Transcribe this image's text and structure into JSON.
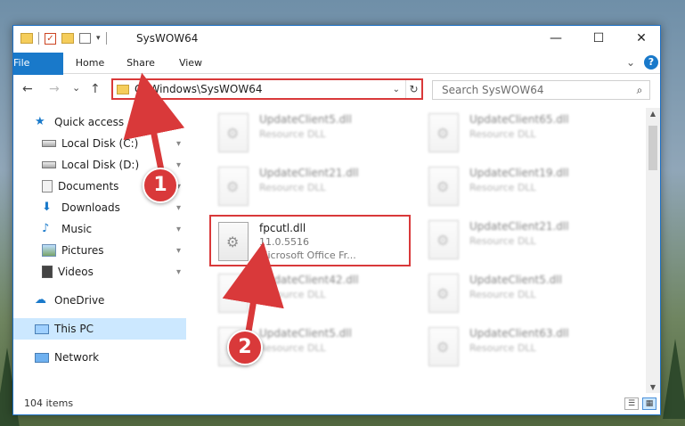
{
  "window": {
    "title": "SysWOW64",
    "controls": {
      "minimize": "—",
      "maximize": "☐",
      "close": "✕"
    }
  },
  "qat": {
    "check": "✓",
    "dropdown": "▾"
  },
  "ribbon": {
    "tabs": [
      {
        "label": "File"
      },
      {
        "label": "Home"
      },
      {
        "label": "Share"
      },
      {
        "label": "View"
      }
    ],
    "expand": "⌄",
    "help": "?"
  },
  "nav": {
    "back": "←",
    "forward": "→",
    "recent": "⌄",
    "up": "↑"
  },
  "address": {
    "path": "C:\\Windows\\SysWOW64",
    "chevron": "⌄",
    "refresh": "↻"
  },
  "search": {
    "placeholder": "Search SysWOW64",
    "icon": "⌕"
  },
  "sidebar": {
    "items": [
      {
        "label": "Quick access",
        "icon": "star-icon",
        "pinned": false
      },
      {
        "label": "Local Disk (C:)",
        "icon": "drive-icon",
        "pinned": true
      },
      {
        "label": "Local Disk (D:)",
        "icon": "drive-icon",
        "pinned": true
      },
      {
        "label": "Documents",
        "icon": "documents-icon",
        "pinned": true
      },
      {
        "label": "Downloads",
        "icon": "download-icon",
        "pinned": true
      },
      {
        "label": "Music",
        "icon": "music-icon",
        "pinned": true
      },
      {
        "label": "Pictures",
        "icon": "pictures-icon",
        "pinned": true
      },
      {
        "label": "Videos",
        "icon": "videos-icon",
        "pinned": true
      },
      {
        "label": "OneDrive",
        "icon": "cloud-icon",
        "pinned": false
      },
      {
        "label": "This PC",
        "icon": "computer-icon",
        "pinned": false,
        "selected": true
      },
      {
        "label": "Network",
        "icon": "network-icon",
        "pinned": false
      }
    ],
    "pin_glyph": "📌"
  },
  "files": [
    {
      "name": "UpdateClient5.dll",
      "sub": "Resource DLL",
      "blur": true
    },
    {
      "name": "UpdateClient65.dll",
      "sub": "Resource DLL",
      "blur": true
    },
    {
      "name": "UpdateClient21.dll",
      "sub": "Resource DLL",
      "blur": true
    },
    {
      "name": "UpdateClient19.dll",
      "sub": "Resource DLL",
      "blur": true
    },
    {
      "name": "fpcutl.dll",
      "sub": "11.0.5516",
      "sub2": "Microsoft Office Fr...",
      "blur": false
    },
    {
      "name": "UpdateClient21.dll",
      "sub": "Resource DLL",
      "blur": true
    },
    {
      "name": "UpdateClient42.dll",
      "sub": "Resource DLL",
      "blur": true
    },
    {
      "name": "UpdateClient5.dll",
      "sub": "Resource DLL",
      "blur": true
    },
    {
      "name": "UpdateClient5.dll",
      "sub": "Resource DLL",
      "blur": true
    },
    {
      "name": "UpdateClient63.dll",
      "sub": "Resource DLL",
      "blur": true
    }
  ],
  "status": {
    "count": "104 items"
  },
  "callouts": {
    "one": "1",
    "two": "2"
  },
  "colors": {
    "accent": "#1979ca",
    "highlight": "#d9393a",
    "selection": "#cce8ff"
  }
}
